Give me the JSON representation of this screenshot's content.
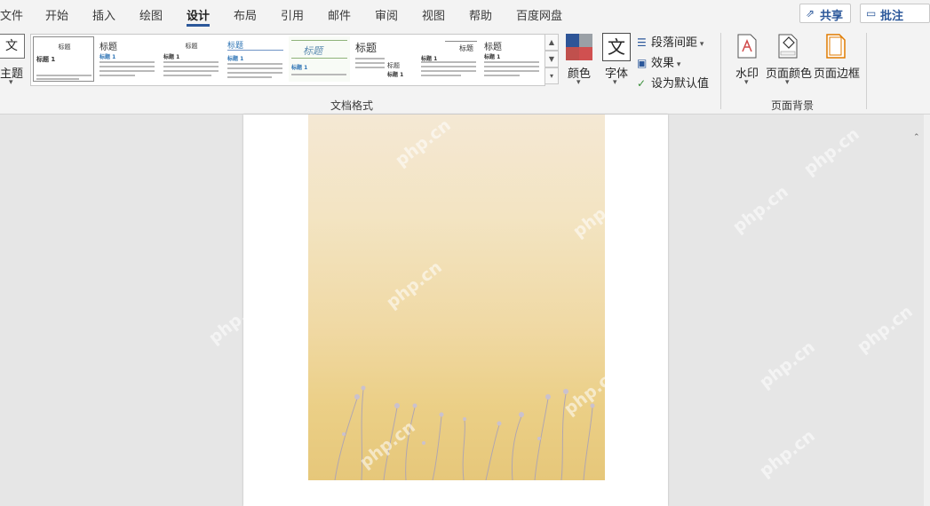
{
  "tabs": [
    {
      "label": "文件"
    },
    {
      "label": "开始"
    },
    {
      "label": "插入"
    },
    {
      "label": "绘图"
    },
    {
      "label": "设计"
    },
    {
      "label": "布局"
    },
    {
      "label": "引用"
    },
    {
      "label": "邮件"
    },
    {
      "label": "审阅"
    },
    {
      "label": "视图"
    },
    {
      "label": "帮助"
    },
    {
      "label": "百度网盘"
    }
  ],
  "active_tab": "设计",
  "share": {
    "label": "共享"
  },
  "comments": {
    "label": "批注"
  },
  "ribbon": {
    "theme": {
      "icon_text": "文",
      "label": "主题"
    },
    "styles": [
      {
        "title": "标题",
        "sub": "标题 1"
      },
      {
        "title": "标题",
        "sub": "标题 1"
      },
      {
        "title": "标题",
        "sub": "标题 1"
      },
      {
        "title": "标题",
        "sub": "标题 1"
      },
      {
        "title": "标题",
        "sub": "标题 1"
      },
      {
        "title": "标题",
        "sub": ""
      },
      {
        "title": "标题",
        "sub": "标题 1"
      },
      {
        "title": "标题",
        "sub": "标题 1"
      },
      {
        "title": "标题",
        "sub": "标题 1"
      }
    ],
    "colors": {
      "label": "颜色"
    },
    "fonts": {
      "icon_text": "文",
      "label": "字体"
    },
    "paragraph_spacing": {
      "label": "段落间距"
    },
    "effects": {
      "label": "效果"
    },
    "set_default": {
      "label": "设为默认值"
    },
    "group_doc_format": "文档格式",
    "watermark": {
      "label": "水印"
    },
    "page_color": {
      "label": "页面颜色"
    },
    "page_borders": {
      "label": "页面边框"
    },
    "group_page_background": "页面背景"
  },
  "watermark_text": "php.cn",
  "colors": {
    "accent": "#2b579a",
    "swatch_blue": "#2e5597",
    "swatch_red": "#c0504d",
    "swatch_gray": "#9aa0a6",
    "swatch_red2": "#d05050"
  }
}
